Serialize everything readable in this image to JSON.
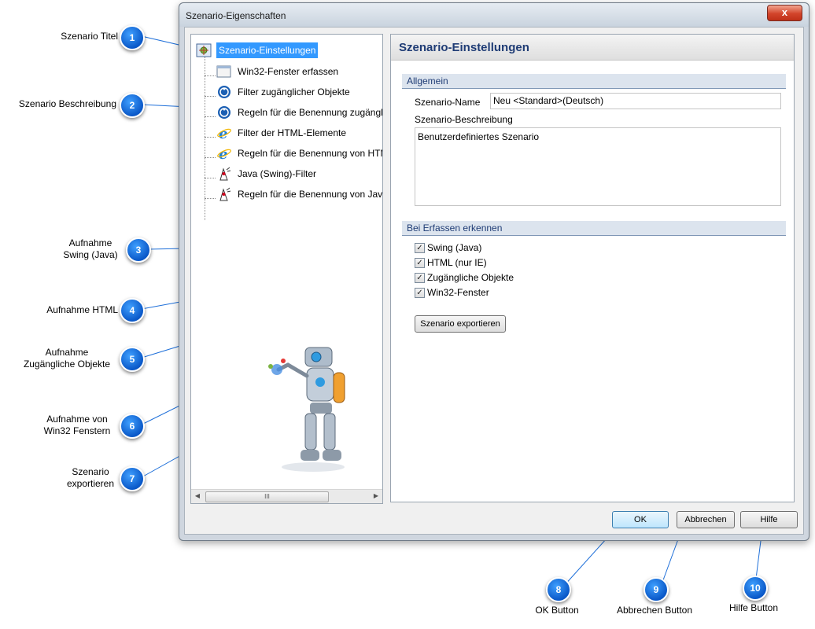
{
  "window": {
    "title": "Szenario-Eigenschaften",
    "close_glyph": "x"
  },
  "tree": {
    "root_label": "Szenario-Einstellungen",
    "items": [
      {
        "label": "Win32-Fenster erfassen",
        "icon": "window-icon"
      },
      {
        "label": "Filter zugänglicher Objekte",
        "icon": "accessibility-icon"
      },
      {
        "label": "Regeln für die Benennung zugängl",
        "icon": "accessibility-icon"
      },
      {
        "label": "Filter der HTML-Elemente",
        "icon": "internet-explorer-icon"
      },
      {
        "label": "Regeln für die Benennung von HTM",
        "icon": "internet-explorer-icon"
      },
      {
        "label": "Java (Swing)-Filter",
        "icon": "java-duke-icon"
      },
      {
        "label": "Regeln für die Benennung von Java",
        "icon": "java-duke-icon"
      }
    ],
    "scroll_grip": "III"
  },
  "panel": {
    "heading": "Szenario-Einstellungen",
    "section_general": "Allgemein",
    "name_label": "Szenario-Name",
    "name_value": "Neu <Standard>(Deutsch)",
    "desc_label": "Szenario-Beschreibung",
    "desc_value": "Benutzerdefiniertes Szenario",
    "section_detect": "Bei Erfassen erkennen",
    "checkboxes": [
      {
        "label": "Swing (Java)",
        "checked": true
      },
      {
        "label": "HTML (nur IE)",
        "checked": true
      },
      {
        "label": "Zugängliche Objekte",
        "checked": true
      },
      {
        "label": "Win32-Fenster",
        "checked": true
      }
    ],
    "check_glyph": "✓",
    "export_button": "Szenario exportieren"
  },
  "buttons": {
    "ok": "OK",
    "cancel": "Abbrechen",
    "help": "Hilfe"
  },
  "annotations": [
    {
      "num": "1",
      "lines": [
        "Szenario Titel"
      ]
    },
    {
      "num": "2",
      "lines": [
        "Szenario Beschreibung"
      ]
    },
    {
      "num": "3",
      "lines": [
        "Aufnahme",
        "Swing (Java)"
      ]
    },
    {
      "num": "4",
      "lines": [
        "Aufnahme HTML"
      ]
    },
    {
      "num": "5",
      "lines": [
        "Aufnahme",
        "Zugängliche Objekte"
      ]
    },
    {
      "num": "6",
      "lines": [
        "Aufnahme von",
        "Win32 Fenstern"
      ]
    },
    {
      "num": "7",
      "lines": [
        "Szenario",
        "exportieren"
      ]
    },
    {
      "num": "8",
      "lines": [
        "OK Button"
      ]
    },
    {
      "num": "9",
      "lines": [
        "Abbrechen Button"
      ]
    },
    {
      "num": "10",
      "lines": [
        "Hilfe Button"
      ]
    }
  ],
  "colors": {
    "bubble": "#0a58c8",
    "callout_line": "#1e6fd9",
    "selection": "#3399ff",
    "heading": "#1f3c75"
  }
}
